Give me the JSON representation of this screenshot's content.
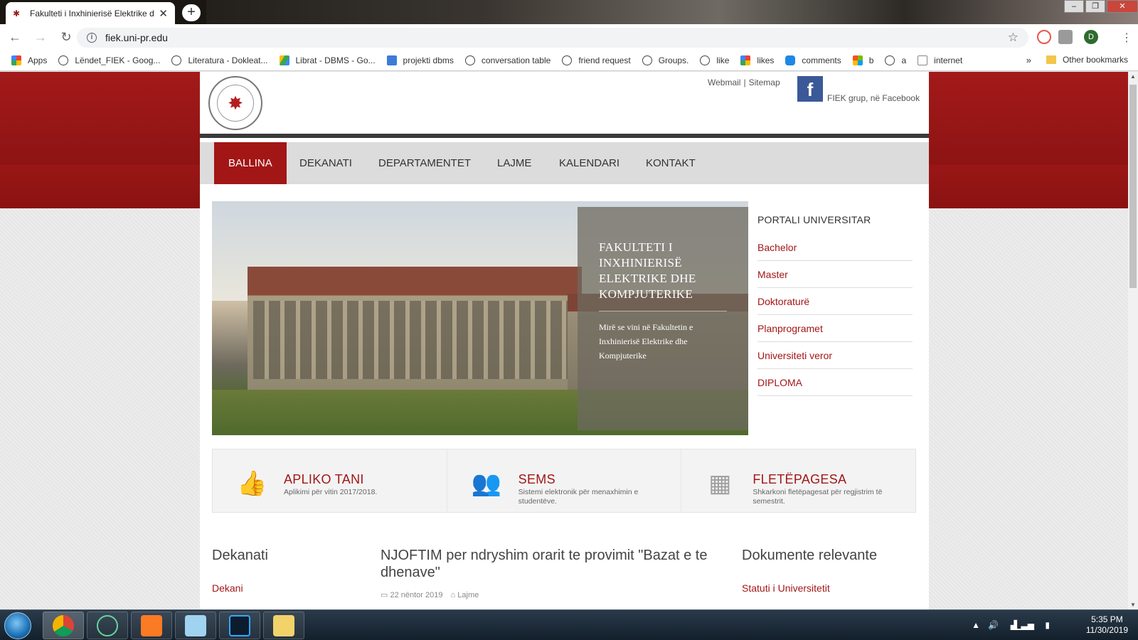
{
  "browser": {
    "tab_title": "Fakulteti i Inxhinierisë Elektrike dhe Kompjuterike",
    "url": "fiek.uni-pr.edu",
    "profile_initial": "D",
    "bookmarks": [
      {
        "label": "Apps",
        "icon": "apps-grid-icon"
      },
      {
        "label": "Lëndet_FIEK - Goog...",
        "icon": "globe-icon"
      },
      {
        "label": "Literatura - Dokleat...",
        "icon": "globe-icon"
      },
      {
        "label": "Librat - DBMS - Go...",
        "icon": "drive-icon"
      },
      {
        "label": "projekti dbms",
        "icon": "p-icon"
      },
      {
        "label": "conversation table",
        "icon": "bulb-icon"
      },
      {
        "label": "friend request",
        "icon": "bulb-icon"
      },
      {
        "label": "Groups.",
        "icon": "bulb-icon"
      },
      {
        "label": "like",
        "icon": "bulb-icon"
      },
      {
        "label": "likes",
        "icon": "apps-grid-icon"
      },
      {
        "label": "comments",
        "icon": "db-icon"
      },
      {
        "label": "b",
        "icon": "windows-icon"
      },
      {
        "label": "a",
        "icon": "globe-icon"
      },
      {
        "label": "internet",
        "icon": "ost-icon"
      }
    ],
    "bookmarks_more": "»",
    "other_bookmarks": "Other bookmarks"
  },
  "site": {
    "top_links": [
      "Webmail",
      "Sitemap"
    ],
    "facebook_label": "FIEK grup, në Facebook",
    "menu": [
      {
        "label": "BALLINA",
        "active": true
      },
      {
        "label": "DEKANATI",
        "active": false
      },
      {
        "label": "DEPARTAMENTET",
        "active": false
      },
      {
        "label": "LAJME",
        "active": false
      },
      {
        "label": "KALENDARI",
        "active": false
      },
      {
        "label": "KONTAKT",
        "active": false
      }
    ],
    "slider": {
      "title": "FAKULTETI I INXHINIERISË ELEKTRIKE DHE KOMPJUTERIKE",
      "text": "Mirë se vini në Fakultetin e Inxhinierisë Elektrike dhe Kompjuterike"
    },
    "portal": {
      "heading": "PORTALI UNIVERSITAR",
      "links": [
        "Bachelor",
        "Master",
        "Doktoraturë",
        "Planprogramet",
        "Universiteti veror",
        "DIPLOMA"
      ]
    },
    "boxes": [
      {
        "title": "APLIKO TANI",
        "subtitle": "Aplikimi për vitin 2017/2018.",
        "icon": "thumbs-up-icon"
      },
      {
        "title": "SEMS",
        "subtitle": "Sistemi elektronik për menaxhimin e studentëve.",
        "icon": "users-icon"
      },
      {
        "title": "FLETËPAGESA",
        "subtitle": "Shkarkoni fletëpagesat për regjistrim të semestrit.",
        "icon": "calendar-icon"
      }
    ],
    "dekanati": {
      "heading": "Dekanati",
      "link": "Dekani"
    },
    "news": {
      "title": "NJOFTIM per ndryshim orarit te provimit \"Bazat e te dhenave\"",
      "date": "22 nëntor 2019",
      "category": "Lajme"
    },
    "docs": {
      "heading": "Dokumente relevante",
      "link": "Statuti i Universitetit"
    }
  },
  "taskbar": {
    "time": "5:35 PM",
    "date": "11/30/2019",
    "apps": [
      "chrome",
      "atom",
      "xampp",
      "notepad",
      "photoshop",
      "explorer"
    ]
  }
}
